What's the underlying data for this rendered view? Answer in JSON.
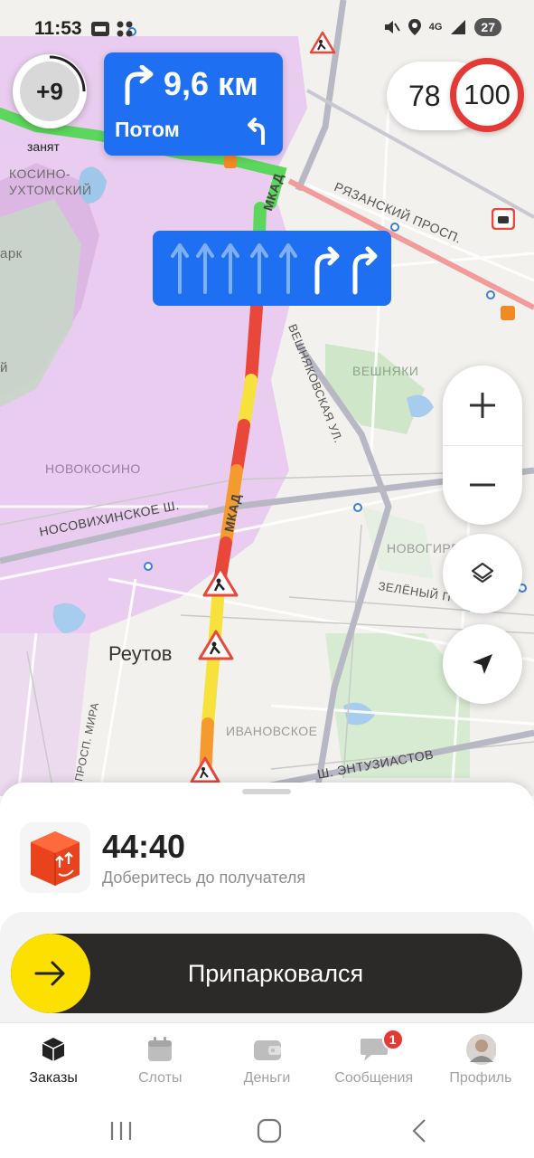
{
  "status_bar": {
    "time": "11:53",
    "battery": "27",
    "network": "4G"
  },
  "nav": {
    "level_value": "+9",
    "level_status": "занят",
    "maneuver_distance": "9,6 км",
    "maneuver_then": "Потом",
    "current_speed": "78",
    "speed_limit": "100"
  },
  "map": {
    "labels": {
      "kosino": "КОСИНО-\nУХТОМСКИЙ",
      "park": "арк",
      "ryazansky": "РЯЗАНСКИЙ ПРОСП.",
      "mkad_top": "МКАД",
      "mkad_mid": "МКАД",
      "veshnyakovskaya": "ВЕШНЯКОВСКАЯ УЛ.",
      "veshnyaki": "ВЕШНЯКИ",
      "novokosino": "НОВОКОСИНО",
      "nosovikhinskoe": "НОСОВИХИНСКОЕ Ш.",
      "novogireevo": "НОВОГИРЕ",
      "zeleny": "ЗЕЛЁНЫЙ П",
      "reutov": "Реутов",
      "ivanovskoe": "ИВАНОВСКОЕ",
      "entuziastov": "Ш. ЭНТУЗИАСТОВ",
      "mira": "ПРОСП. МИРА",
      "side_letter": "й"
    },
    "colors": {
      "route_green": "#5cd65c",
      "traffic_red": "#e8473a",
      "traffic_yellow": "#f7e13d",
      "traffic_orange": "#f59a2f"
    }
  },
  "order": {
    "eta": "44:40",
    "description": "Доберитесь до получателя",
    "slider_label": "Припарковался"
  },
  "tabs": [
    {
      "label": "Заказы",
      "icon": "box-icon",
      "active": true
    },
    {
      "label": "Слоты",
      "icon": "calendar-icon",
      "active": false
    },
    {
      "label": "Деньги",
      "icon": "wallet-icon",
      "active": false
    },
    {
      "label": "Сообщения",
      "icon": "chat-icon",
      "active": false,
      "badge": "1"
    },
    {
      "label": "Профиль",
      "icon": "avatar-icon",
      "active": false
    }
  ]
}
